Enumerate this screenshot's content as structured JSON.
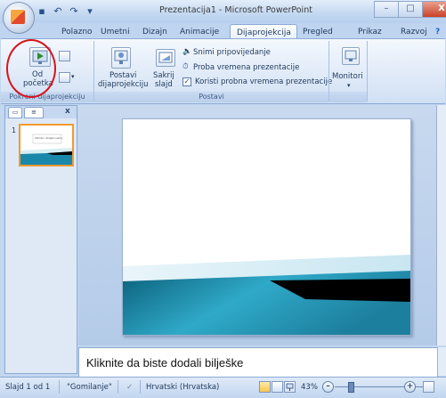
{
  "window": {
    "title": "Prezentacija1 - Microsoft PowerPoint",
    "minimize": "–",
    "maximize": "□",
    "close": "X"
  },
  "qat": {
    "save": "▪",
    "undo": "↶",
    "redo": "↷",
    "more": "▾"
  },
  "tabs": [
    "Polazno",
    "Umetni",
    "Dizajn",
    "Animacije",
    "Dijaprojekcija",
    "Pregled",
    "Prikaz",
    "Razvoj"
  ],
  "active_tab": "Dijaprojekcija",
  "ribbon": {
    "group1": {
      "label": "Pokreni dijaprojekciju",
      "from_start_line1": "Od",
      "from_start_line2": "početka"
    },
    "group2": {
      "label": "Postavi",
      "setup_line1": "Postavi",
      "setup_line2": "dijaprojekciju",
      "hide_line1": "Sakrij",
      "hide_line2": "slajd",
      "record_narration": "Snimi pripovijedanje",
      "rehearse_timings": "Proba vremena prezentacije",
      "use_rehearsed": "Koristi probna vremena prezentacije",
      "use_rehearsed_checked": true
    },
    "group3": {
      "monitors_label": "Monitori",
      "monitors_arrow": "▾"
    }
  },
  "left_pane": {
    "tab_slides": "▭",
    "tab_outline": "≡",
    "close": "x",
    "thumb_number": "1"
  },
  "thumbnail_text": "Kliknite i dodajte naslov",
  "notes_placeholder": "Kliknite da biste dodali bilješke",
  "status": {
    "slide_info": "Slajd 1 od 1",
    "theme": "\"Gomilanje\"",
    "language": "Hrvatski (Hrvatska)",
    "zoom": "43%",
    "zoom_minus": "–",
    "zoom_plus": "+"
  },
  "zoom_fraction": 0.43,
  "colors": {
    "slide_wave_dark": "#0b5f79",
    "slide_wave_light": "#2fa9c8",
    "slide_black_band": "#000000",
    "annotation_red": "#d8141c"
  }
}
